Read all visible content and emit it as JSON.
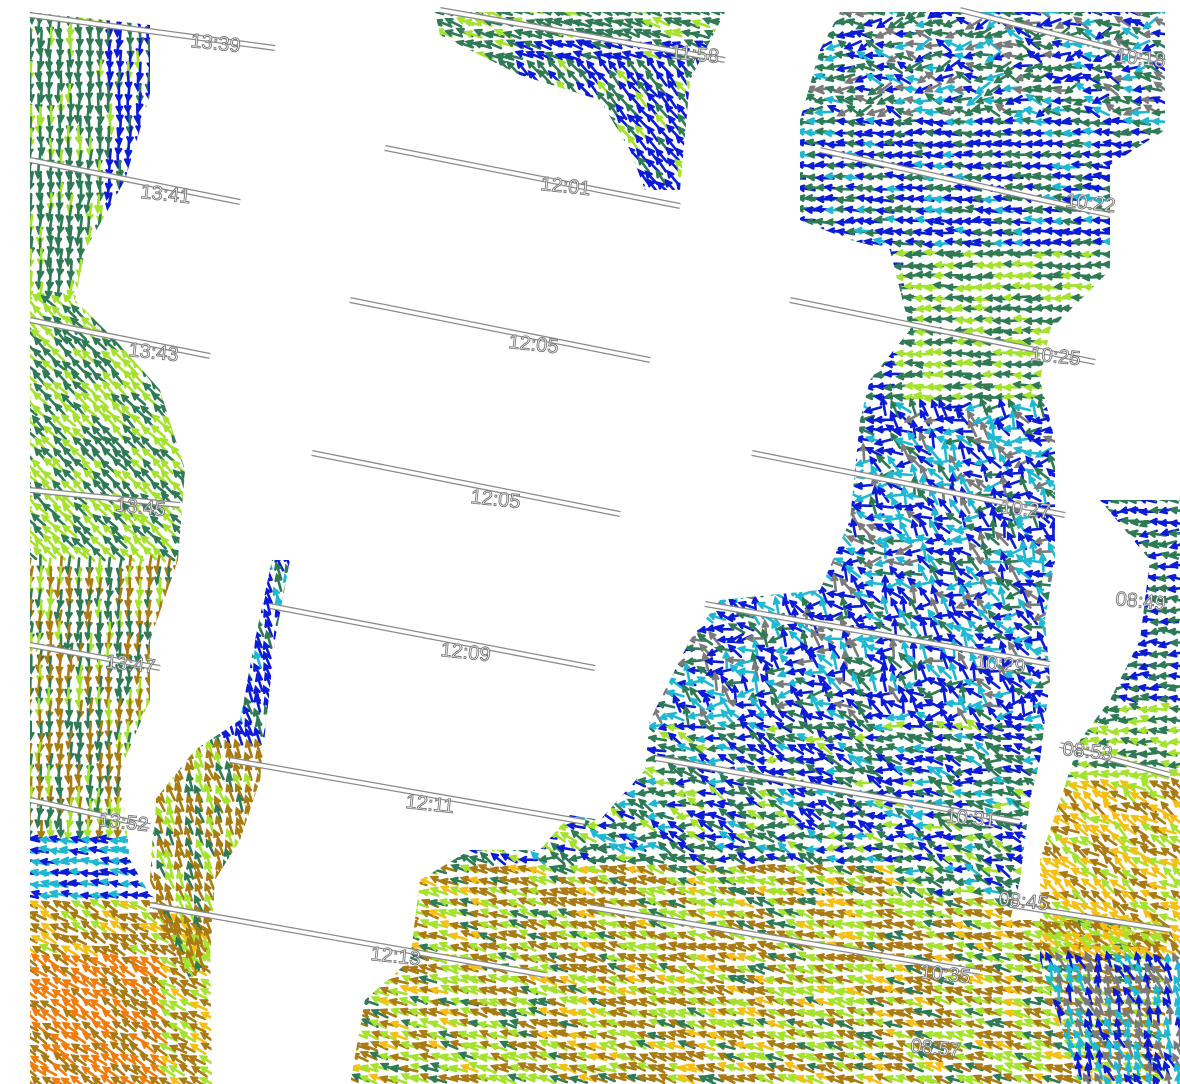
{
  "map": {
    "arrow_colors": [
      "#0c1bd6",
      "#2e7a55",
      "#a5e22d",
      "#1fb8d2",
      "#a97b12",
      "#f5bf14",
      "#f07c0c",
      "#7a7a7a"
    ],
    "track_times": [
      "13:39",
      "13:41",
      "13:43",
      "13:45",
      "13:47",
      "13:52",
      "11:58",
      "12:01",
      "12:05",
      "12:05",
      "12:09",
      "12:11",
      "12:13",
      "10:18",
      "10:22",
      "10:25",
      "10:27",
      "10:29",
      "10:31",
      "10:35",
      "08:49",
      "08:53",
      "08:45",
      "08:57"
    ]
  }
}
